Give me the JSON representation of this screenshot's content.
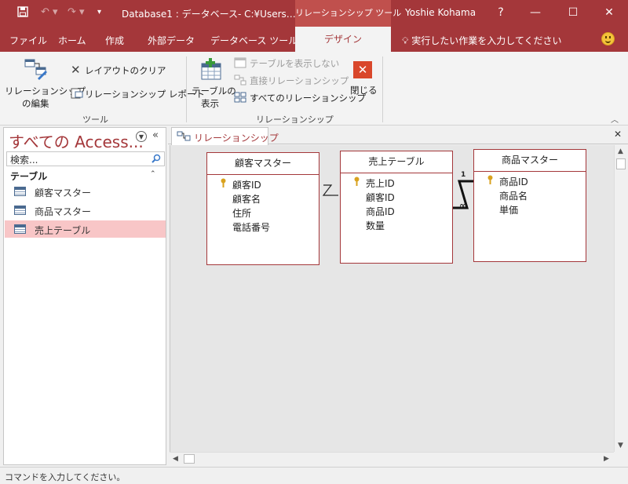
{
  "titlebar": {
    "doc_title": "Database1 : データベース- C:¥Users…",
    "context_tab": "リレーションシップ ツール",
    "user": "Yoshie Kohama",
    "help": "?",
    "minimize": "—",
    "restore": "☐",
    "close": "✕"
  },
  "ribbon_tabs": [
    "ファイル",
    "ホーム",
    "作成",
    "外部データ",
    "データベース ツール",
    "デザイン"
  ],
  "tell_me": "実行したい作業を入力してください",
  "ribbon": {
    "edit_relationship_line1": "リレーションシップ",
    "edit_relationship_line2": "の編集",
    "clear_layout": "レイアウトのクリア",
    "relationship_report": "リレーションシップ レポート",
    "group_tools": "ツール",
    "show_table_line1": "テーブルの",
    "show_table_line2": "表示",
    "hide_table": "テーブルを表示しない",
    "direct_relationships": "直接リレーションシップ",
    "all_relationships": "すべてのリレーションシップ",
    "close": "閉じる",
    "group_relationships": "リレーションシップ"
  },
  "nav": {
    "title": "すべての Access...",
    "search_placeholder": "検索...",
    "section": "テーブル",
    "items": [
      "顧客マスター",
      "商品マスター",
      "売上テーブル"
    ]
  },
  "doc_tab": "リレーションシップ",
  "tables": [
    {
      "name": "顧客マスター",
      "fields": [
        "顧客ID",
        "顧客名",
        "住所",
        "電話番号"
      ]
    },
    {
      "name": "売上テーブル",
      "fields": [
        "売上ID",
        "顧客ID",
        "商品ID",
        "数量"
      ]
    },
    {
      "name": "商品マスター",
      "fields": [
        "商品ID",
        "商品名",
        "単価"
      ]
    }
  ],
  "relationship_marks": {
    "one": "1",
    "many": "∞"
  },
  "status": "コマンドを入力してください。"
}
